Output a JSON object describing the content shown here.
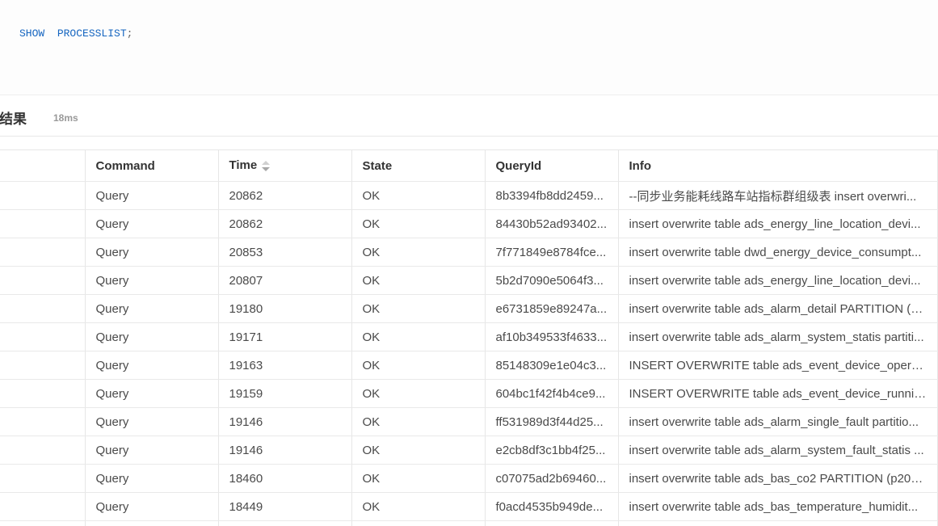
{
  "editor": {
    "sql_keyword_1": "SHOW",
    "sql_keyword_2": "PROCESSLIST",
    "sql_terminator": ";"
  },
  "result": {
    "title": "结果",
    "duration": "18ms"
  },
  "table": {
    "columns": [
      "",
      "Command",
      "Time",
      "State",
      "QueryId",
      "Info"
    ],
    "sorted_column": "Time",
    "rows": [
      {
        "command": "Query",
        "time": "20862",
        "state": "OK",
        "query_id": "8b3394fb8dd2459...",
        "info": "--同步业务能耗线路车站指标群组级表 insert overwri..."
      },
      {
        "command": "Query",
        "time": "20862",
        "state": "OK",
        "query_id": "84430b52ad93402...",
        "info": "insert overwrite table ads_energy_line_location_devi..."
      },
      {
        "command": "Query",
        "time": "20853",
        "state": "OK",
        "query_id": "7f771849e8784fce...",
        "info": "insert overwrite table dwd_energy_device_consumpt..."
      },
      {
        "command": "Query",
        "time": "20807",
        "state": "OK",
        "query_id": "5b2d7090e5064f3...",
        "info": "insert overwrite table ads_energy_line_location_devi..."
      },
      {
        "command": "Query",
        "time": "19180",
        "state": "OK",
        "query_id": "e6731859e89247a...",
        "info": "insert overwrite table ads_alarm_detail PARTITION (p..."
      },
      {
        "command": "Query",
        "time": "19171",
        "state": "OK",
        "query_id": "af10b349533f4633...",
        "info": "insert overwrite table ads_alarm_system_statis partiti..."
      },
      {
        "command": "Query",
        "time": "19163",
        "state": "OK",
        "query_id": "85148309e1e04c3...",
        "info": "INSERT OVERWRITE table ads_event_device_operati..."
      },
      {
        "command": "Query",
        "time": "19159",
        "state": "OK",
        "query_id": "604bc1f42f4b4ce9...",
        "info": "INSERT OVERWRITE table ads_event_device_running..."
      },
      {
        "command": "Query",
        "time": "19146",
        "state": "OK",
        "query_id": "ff531989d3f44d25...",
        "info": "insert overwrite table ads_alarm_single_fault partitio..."
      },
      {
        "command": "Query",
        "time": "19146",
        "state": "OK",
        "query_id": "e2cb8df3c1bb4f25...",
        "info": "insert overwrite table ads_alarm_system_fault_statis ..."
      },
      {
        "command": "Query",
        "time": "18460",
        "state": "OK",
        "query_id": "c07075ad2b69460...",
        "info": "insert overwrite table ads_bas_co2 PARTITION (p202..."
      },
      {
        "command": "Query",
        "time": "18449",
        "state": "OK",
        "query_id": "f0acd4535b949de...",
        "info": "insert overwrite table ads_bas_temperature_humidit..."
      },
      {
        "command": "Query",
        "time": "",
        "state": "",
        "query_id": "",
        "info": ""
      }
    ]
  }
}
